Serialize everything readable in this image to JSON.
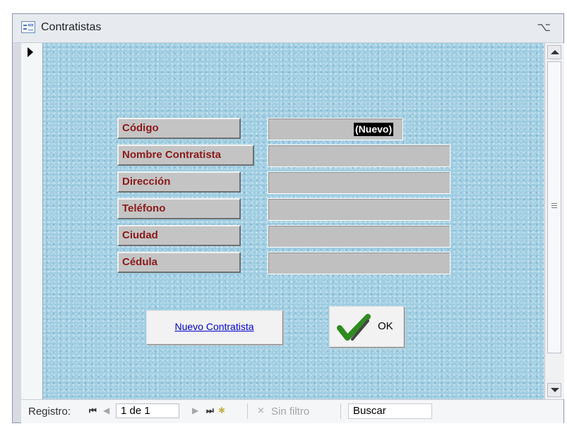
{
  "window": {
    "title": "Contratistas",
    "close_glyph": "⌥"
  },
  "form": {
    "fields": [
      {
        "label": "Código",
        "value": "(Nuevo)"
      },
      {
        "label": "Nombre Contratista",
        "value": ""
      },
      {
        "label": "Dirección",
        "value": ""
      },
      {
        "label": "Teléfono",
        "value": ""
      },
      {
        "label": "Ciudad",
        "value": ""
      },
      {
        "label": "Cédula",
        "value": ""
      }
    ],
    "new_button_label": "Nuevo Contratista",
    "ok_button_label": "OK"
  },
  "navigation": {
    "record_label": "Registro:",
    "record_value": "1 de 1",
    "no_filter_label": "Sin filtro",
    "search_label": "Buscar",
    "icons": {
      "first": "first-record-icon",
      "prev": "previous-record-icon",
      "next": "next-record-icon",
      "last": "last-record-icon",
      "new": "new-record-icon",
      "filter": "filter-icon"
    }
  },
  "colors": {
    "label_text": "#8b1a1a",
    "detail_background": "#9ecde2",
    "link_text": "#0000cc",
    "check_green": "#2e8b1f"
  }
}
